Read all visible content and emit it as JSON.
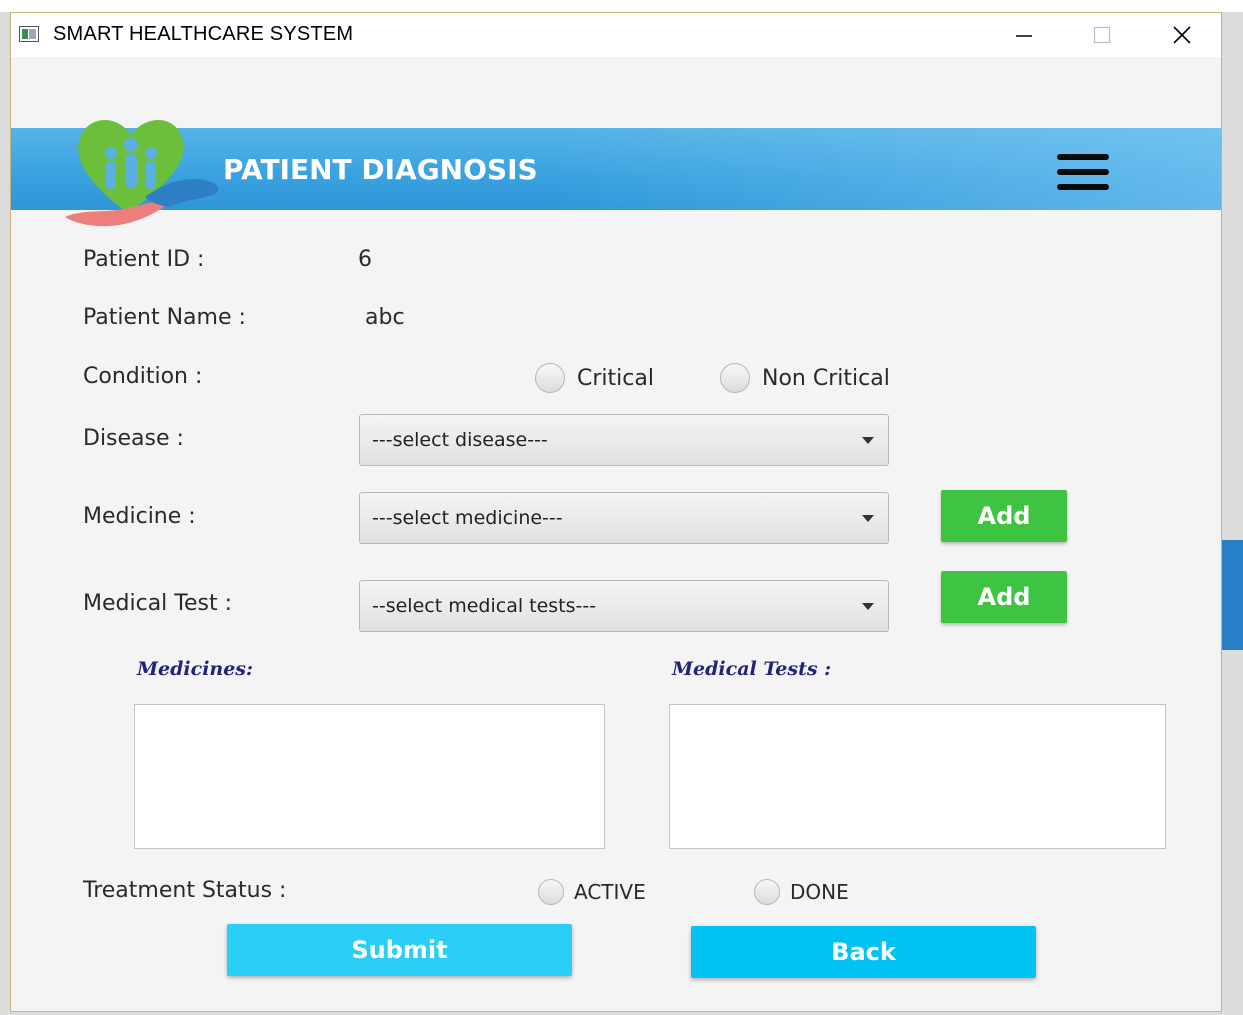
{
  "window": {
    "title": "SMART HEALTHCARE SYSTEM",
    "minimize_icon": "minimize-icon",
    "maximize_icon": "maximize-icon",
    "close_icon": "close-icon"
  },
  "header": {
    "title": "PATIENT DIAGNOSIS",
    "menu_icon": "hamburger-menu-icon"
  },
  "form": {
    "patient_id_label": "Patient ID :",
    "patient_id_value": "6",
    "patient_name_label": "Patient Name :",
    "patient_name_value": "abc",
    "condition_label": "Condition :",
    "condition_options": [
      "Critical",
      "Non Critical"
    ],
    "disease_label": "Disease :",
    "disease_placeholder": "---select disease---",
    "medicine_label": "Medicine :",
    "medicine_placeholder": "---select medicine---",
    "medicine_add": "Add",
    "medical_test_label": "Medical Test :",
    "medical_test_placeholder": "--select medical tests---",
    "medical_test_add": "Add",
    "medicines_list_title": "Medicines:",
    "medical_tests_list_title": "Medical Tests :",
    "treatment_status_label": "Treatment Status :",
    "treatment_status_options": [
      "ACTIVE",
      "DONE"
    ]
  },
  "actions": {
    "submit": "Submit",
    "back": "Back"
  },
  "colors": {
    "header_blue": "#39a1df",
    "add_green": "#3ec342",
    "submit_cyan": "#2bcef6",
    "back_cyan": "#00c3f3",
    "list_title": "#23237a"
  }
}
